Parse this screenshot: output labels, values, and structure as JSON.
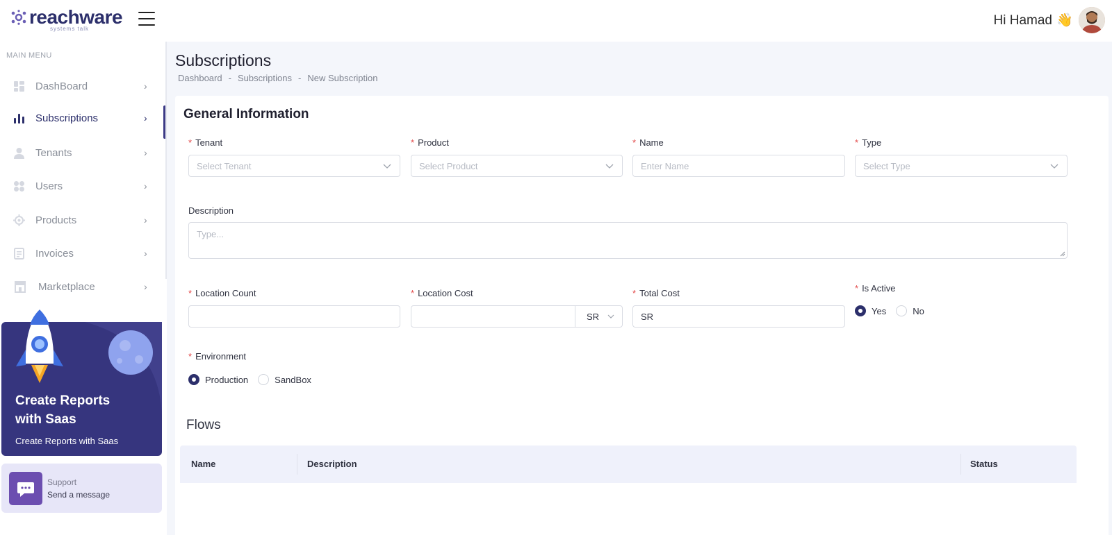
{
  "header": {
    "logo_text": "reachware",
    "logo_tagline": "systems talk",
    "greeting": "Hi Hamad",
    "greeting_emoji": "👋"
  },
  "sidebar": {
    "menu_title": "MAIN MENU",
    "items": [
      {
        "label": "DashBoard",
        "icon": "dashboard-icon"
      },
      {
        "label": "Subscriptions",
        "icon": "bar-chart-icon",
        "active": true
      },
      {
        "label": "Tenants",
        "icon": "user-icon"
      },
      {
        "label": "Users",
        "icon": "users-grid-icon"
      },
      {
        "label": "Products",
        "icon": "product-icon"
      },
      {
        "label": "Invoices",
        "icon": "invoice-icon"
      },
      {
        "label": "Marketplace",
        "icon": "store-icon"
      }
    ],
    "promo": {
      "title": "Create Reports with Saas",
      "subtitle": "Create Reports with Saas"
    },
    "support": {
      "title": "Support",
      "subtitle": "Send a message"
    }
  },
  "page": {
    "title": "Subscriptions",
    "breadcrumb": [
      "Dashboard",
      "Subscriptions",
      "New Subscription"
    ],
    "breadcrumb_sep": "-"
  },
  "form": {
    "section_title": "General Information",
    "tenant": {
      "label": "Tenant",
      "placeholder": "Select Tenant"
    },
    "product": {
      "label": "Product",
      "placeholder": "Select Product"
    },
    "name": {
      "label": "Name",
      "placeholder": "Enter Name"
    },
    "type": {
      "label": "Type",
      "placeholder": "Select Type"
    },
    "description": {
      "label": "Description",
      "placeholder": "Type..."
    },
    "location_count": {
      "label": "Location Count",
      "value": ""
    },
    "location_cost": {
      "label": "Location Cost",
      "value": "",
      "currency": "SR"
    },
    "total_cost": {
      "label": "Total Cost",
      "value": "SR"
    },
    "is_active": {
      "label": "Is Active",
      "options": [
        "Yes",
        "No"
      ],
      "selected": "Yes"
    },
    "environment": {
      "label": "Environment",
      "options": [
        "Production",
        "SandBox"
      ],
      "selected": "Production"
    },
    "required_mark": "*"
  },
  "flows": {
    "title": "Flows",
    "columns": [
      "Name",
      "Description",
      "Status"
    ]
  },
  "colors": {
    "accent": "#2c2f6b",
    "promo_bg": "#36357e",
    "required": "#e34b4b",
    "support_bg": "#e7e6f8"
  }
}
